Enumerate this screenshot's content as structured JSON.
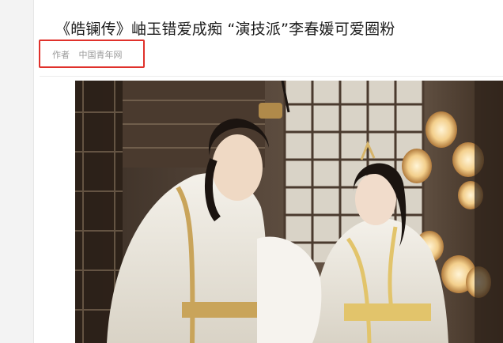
{
  "article": {
    "title": "《皓镧传》岫玉错爱成痴 “演技派”李春媛可爱圈粉",
    "byline_label": "作者",
    "byline_source": "中国青年网"
  },
  "image": {
    "alt": ""
  },
  "colors": {
    "highlight_border": "#e0312b",
    "title_text": "#1c1c1c",
    "meta_text": "#9a9a9a"
  }
}
